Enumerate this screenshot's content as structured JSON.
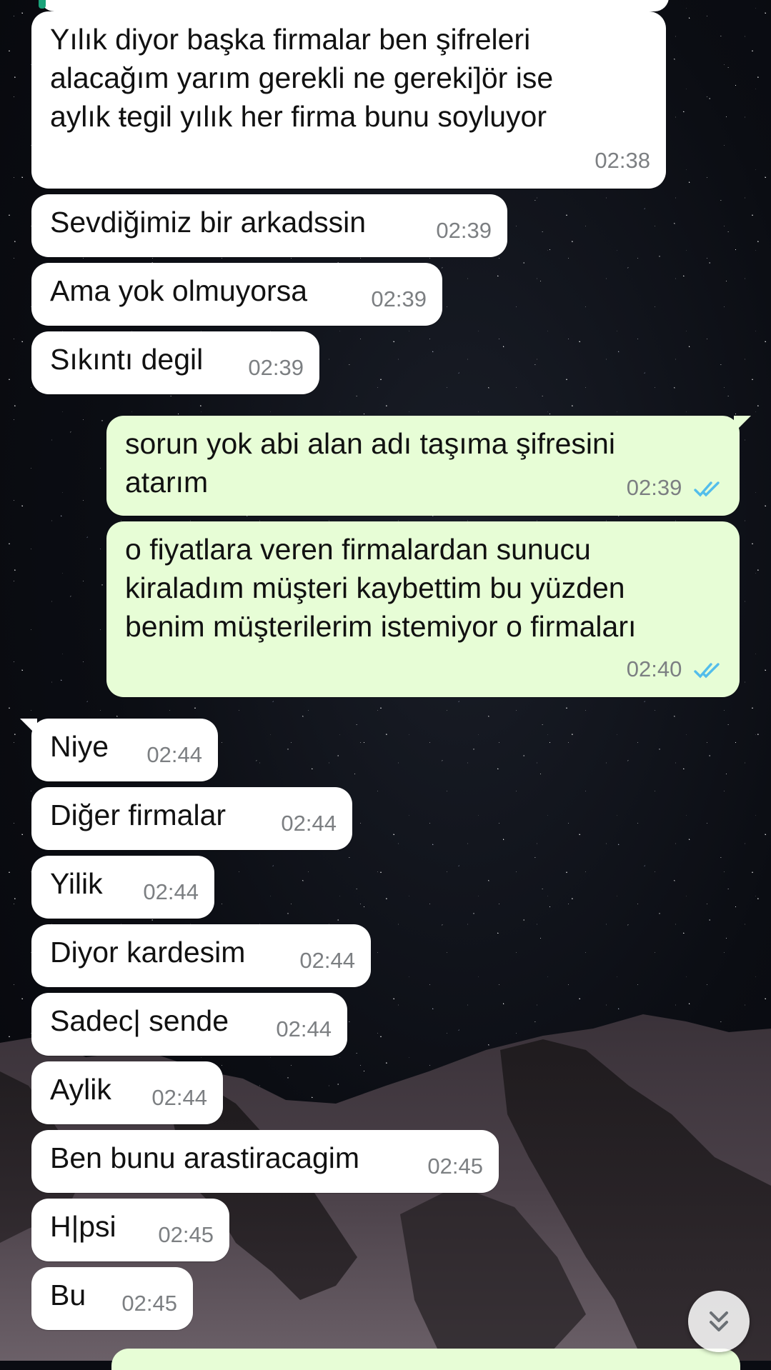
{
  "colors": {
    "incoming_bubble": "#ffffff",
    "outgoing_bubble": "#e7fdd6",
    "read_ticks": "#53bdeb",
    "timestamp": "#7c7f82"
  },
  "messages": [
    {
      "direction": "in",
      "text": "Yılık diyor başka firmalar ben şifreleri\nalacağım yarım gerekli ne gereki]ör ise\naylık ŧegil yılık her firma bunu soyluyor",
      "time": "02:38"
    },
    {
      "direction": "in",
      "text": "Sevdiğimiz bir arkadssin",
      "time": "02:39"
    },
    {
      "direction": "in",
      "text": "Ama yok olmuyorsa",
      "time": "02:39"
    },
    {
      "direction": "in",
      "text": "Sıkıntı degil",
      "time": "02:39"
    },
    {
      "direction": "out",
      "text": "sorun yok abi alan adı taşıma şifresini\natarım",
      "time": "02:39",
      "status": "read"
    },
    {
      "direction": "out",
      "text": "o fiyatlara veren firmalardan sunucu\nkiraladım müşteri kaybettim bu yüzden\nbenim müşterilerim istemiyor o firmaları",
      "time": "02:40",
      "status": "read"
    },
    {
      "direction": "in",
      "text": "Niye",
      "time": "02:44"
    },
    {
      "direction": "in",
      "text": "Diğer firmalar",
      "time": "02:44"
    },
    {
      "direction": "in",
      "text": "Yilik",
      "time": "02:44"
    },
    {
      "direction": "in",
      "text": "Diyor kardesim",
      "time": "02:44"
    },
    {
      "direction": "in",
      "text": "Sadec| sende",
      "time": "02:44"
    },
    {
      "direction": "in",
      "text": "Aylik",
      "time": "02:44"
    },
    {
      "direction": "in",
      "text": "Ben bunu arastiracagim",
      "time": "02:45"
    },
    {
      "direction": "in",
      "text": "H|psi",
      "time": "02:45"
    },
    {
      "direction": "in",
      "text": "Bu",
      "time": "02:45"
    }
  ],
  "scroll_button": {
    "icon": "double-chevron-down-icon"
  }
}
